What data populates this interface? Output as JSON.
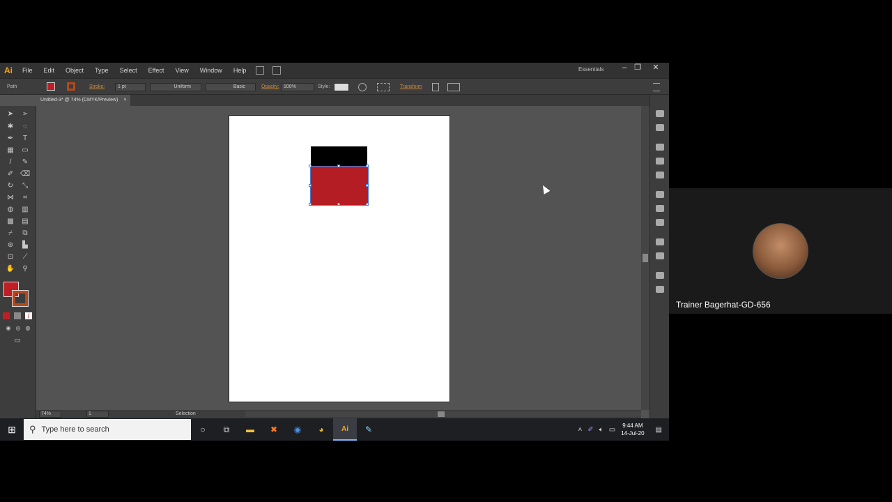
{
  "app": {
    "logo": "Ai",
    "title": "Adobe Illustrator"
  },
  "menu": [
    "File",
    "Edit",
    "Object",
    "Type",
    "Select",
    "Effect",
    "View",
    "Window",
    "Help"
  ],
  "workspace": "Essentials",
  "window_controls": {
    "minimize": "–",
    "restore": "❐",
    "close": "✕"
  },
  "control_bar": {
    "selection_type": "Path",
    "stroke_label": "Stroke:",
    "stroke_weight": "1 pt",
    "profile": "Uniform",
    "brush": "Basic",
    "opacity_label": "Opacity:",
    "opacity_value": "100%",
    "style_label": "Style:",
    "transform_label": "Transform",
    "fill_color": "#bf1e24"
  },
  "document": {
    "tab_title": "Untitled-3* @ 74% (CMYK/Preview)",
    "tab_close": "×",
    "zoom": "74%",
    "page": "1",
    "status": "Selection"
  },
  "artwork": {
    "black_rect_color": "#000000",
    "red_rect_color": "#b51d24"
  },
  "taskbar": {
    "start_icon": "windows-logo",
    "search_placeholder": "Type here to search",
    "apps": [
      "cortana",
      "task-view",
      "file-explorer",
      "xampp",
      "vpn",
      "chrome",
      "illustrator",
      "notepad"
    ],
    "time": "9:44 AM",
    "date": "14-Jul-20"
  },
  "participant": {
    "name": "Trainer Bagerhat-GD-656"
  }
}
